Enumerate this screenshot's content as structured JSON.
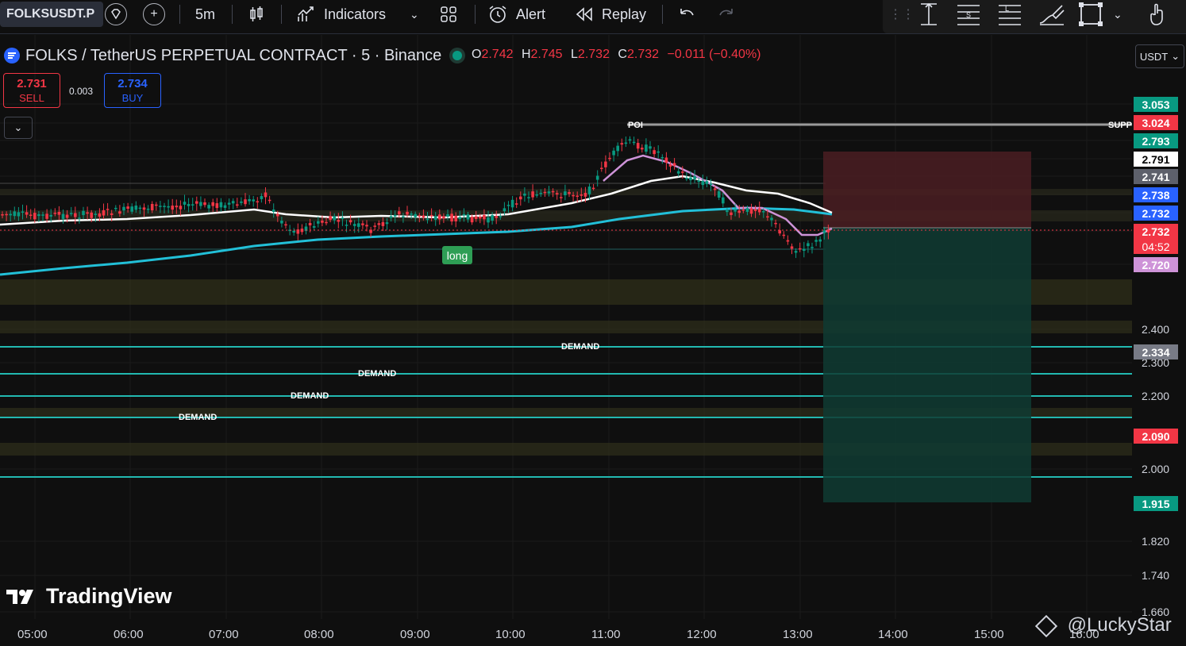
{
  "toolbar": {
    "symbol": "FOLKSUSDT.P",
    "timeframe": "5m",
    "indicators_label": "Indicators",
    "alert_label": "Alert",
    "replay_label": "Replay"
  },
  "legend": {
    "title": "FOLKS / TetherUS PERPETUAL CONTRACT · 5 · Binance",
    "o_key": "O",
    "o_val": "2.742",
    "h_key": "H",
    "h_val": "2.745",
    "l_key": "L",
    "l_val": "2.732",
    "c_key": "C",
    "c_val": "2.732",
    "change": "−0.011 (−0.40%)"
  },
  "trade": {
    "sell_price": "2.731",
    "sell_label": "SELL",
    "spread": "0.003",
    "buy_price": "2.734",
    "buy_label": "BUY"
  },
  "currency": "USDT",
  "price_tags": [
    {
      "text": "3.053",
      "color": "#089981"
    },
    {
      "text": "3.024",
      "color": "#f23645"
    },
    {
      "text": "2.793",
      "color": "#089981"
    },
    {
      "text": "2.791",
      "color": "#ffffff"
    },
    {
      "text": "2.741",
      "color": "#5d606b"
    },
    {
      "text": "2.738",
      "color": "#2962ff"
    },
    {
      "text": "2.732",
      "color": "#2962ff"
    },
    {
      "text": "2.732",
      "color": "#f23645"
    },
    {
      "text": "04:52",
      "color": "#f23645"
    },
    {
      "text": "2.720",
      "color": "#ce93d8"
    },
    {
      "text": "2.334",
      "color": "#787b86"
    },
    {
      "text": "2.090",
      "color": "#f23645"
    },
    {
      "text": "1.915",
      "color": "#089981"
    }
  ],
  "price_labels": [
    "2.400",
    "2.300",
    "2.200",
    "2.000",
    "1.820",
    "1.740",
    "1.660"
  ],
  "time_labels": [
    "05:00",
    "06:00",
    "07:00",
    "08:00",
    "09:00",
    "10:00",
    "11:00",
    "12:00",
    "13:00",
    "14:00",
    "15:00",
    "16:00"
  ],
  "annotations": {
    "poi": "POI",
    "supp": "SUPP",
    "long": "long",
    "demand": [
      "DEMAND",
      "DEMAND",
      "DEMAND",
      "DEMAND"
    ]
  },
  "brand": "TradingView",
  "watermark": "@LuckyStar",
  "colors": {
    "up": "#089981",
    "down": "#f23645",
    "ema_fast": "#ce93d8",
    "ema_mid": "#ffffff",
    "ema_slow": "#22c0d8"
  }
}
